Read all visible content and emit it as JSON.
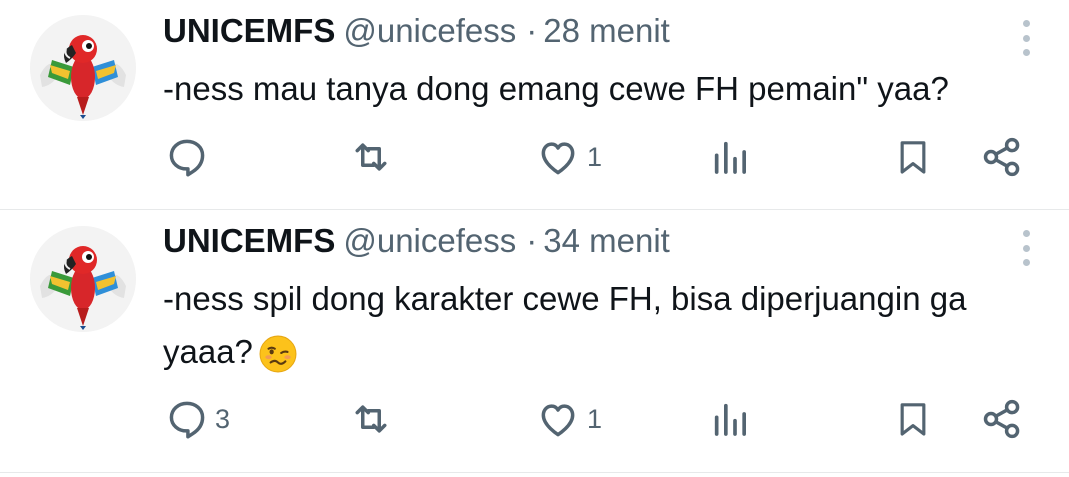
{
  "tweets": [
    {
      "name": "UNICEMFS",
      "handle": "@unicefess",
      "separator": "·",
      "time": "28 menit",
      "text": "-ness mau tanya dong emang cewe FH pemain\" yaa?",
      "emoji": "",
      "counts": {
        "reply": "",
        "retweet": "",
        "like": "1"
      }
    },
    {
      "name": "UNICEMFS",
      "handle": "@unicefess",
      "separator": "·",
      "time": "34 menit",
      "text": "-ness spil dong karakter cewe FH, bisa diperjuangin ga yaaa?",
      "emoji": "woozy-face",
      "counts": {
        "reply": "3",
        "retweet": "",
        "like": "1"
      }
    }
  ],
  "icons": {
    "reply": "reply-bubble-icon",
    "retweet": "retweet-icon",
    "like": "heart-icon",
    "views": "analytics-bars-icon",
    "bookmark": "bookmark-icon",
    "share": "share-nodes-icon",
    "more": "more-vertical-icon"
  },
  "colors": {
    "text": "#0f1419",
    "secondary": "#536471",
    "divider": "#e7e9ea"
  }
}
